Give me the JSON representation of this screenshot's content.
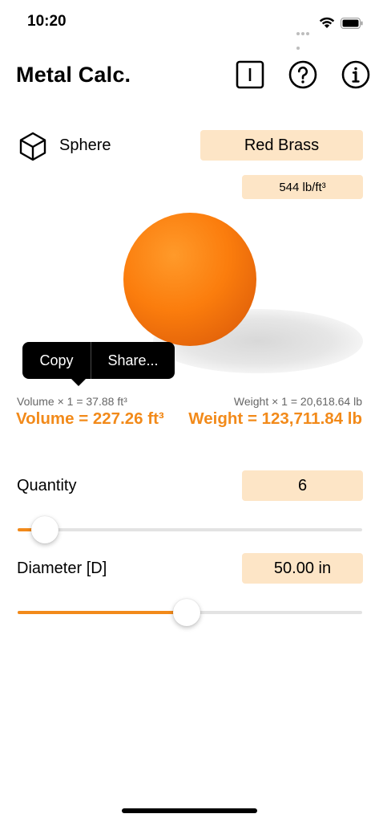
{
  "status": {
    "time": "10:20"
  },
  "header": {
    "title": "Metal Calc."
  },
  "shape": {
    "label": "Sphere"
  },
  "material": {
    "name": "Red Brass",
    "density": "544 lb/ft³"
  },
  "context_menu": {
    "copy": "Copy",
    "share": "Share..."
  },
  "results": {
    "unit_volume": "Volume × 1 = 37.88 ft³",
    "unit_weight": "Weight × 1 = 20,618.64 lb",
    "total_volume": "Volume = 227.26 ft³",
    "total_weight": "Weight = 123,711.84 lb"
  },
  "quantity": {
    "label": "Quantity",
    "value": "6",
    "slider_fraction": 0.08
  },
  "diameter": {
    "label": "Diameter [D]",
    "value": "50.00 in",
    "slider_fraction": 0.49
  },
  "colors": {
    "accent": "#f28a1a",
    "chip": "#fde5c6"
  }
}
